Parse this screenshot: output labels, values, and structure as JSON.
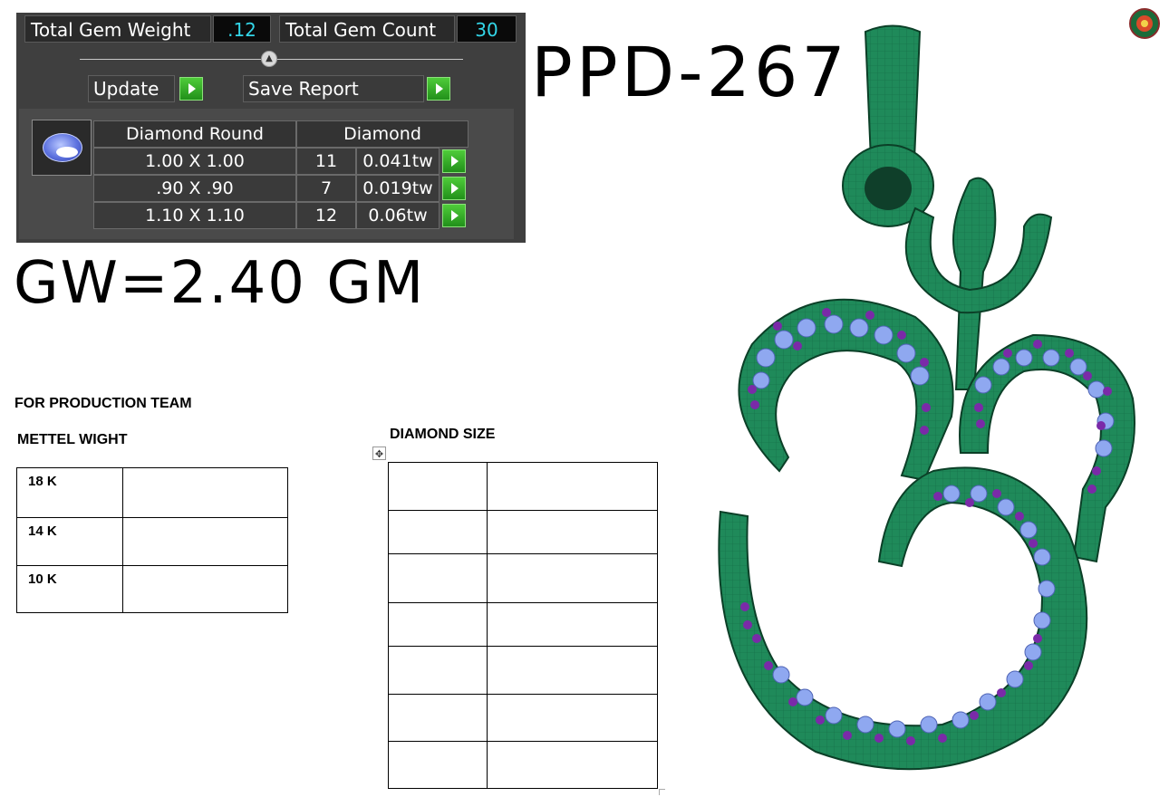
{
  "gem_panel": {
    "total_gem_weight_label": "Total Gem Weight",
    "total_gem_weight_value": ".12",
    "total_gem_count_label": "Total Gem Count",
    "total_gem_count_value": "30",
    "update_button": "Update",
    "save_report_button": "Save Report",
    "gem_table": {
      "columns": [
        "Diamond Round",
        "Diamond"
      ],
      "rows": [
        {
          "size": "1.00 X 1.00",
          "count": "11",
          "weight": "0.041tw"
        },
        {
          "size": ".90 X .90",
          "count": "7",
          "weight": "0.019tw"
        },
        {
          "size": "1.10 X 1.10",
          "count": "12",
          "weight": "0.06tw"
        }
      ]
    }
  },
  "design_code": "PPD-267",
  "gross_weight": "GW=2.40 GM",
  "production": {
    "heading": "FOR PRODUCTION TEAM",
    "metal_weight_heading": "METTEL WIGHT",
    "metal_rows": [
      "18 K",
      "14 K",
      "10 K"
    ],
    "diamond_size_heading": "DIAMOND SIZE",
    "move_handle_glyph": "✥"
  },
  "colors": {
    "panel_bg": "#3f3f3f",
    "value_text": "#33d6e8",
    "button_green": "#2fae24",
    "metal_green": "#1f8a5a",
    "stone_blue": "#8fa8f0",
    "stone_purple": "#7a2aa8"
  }
}
